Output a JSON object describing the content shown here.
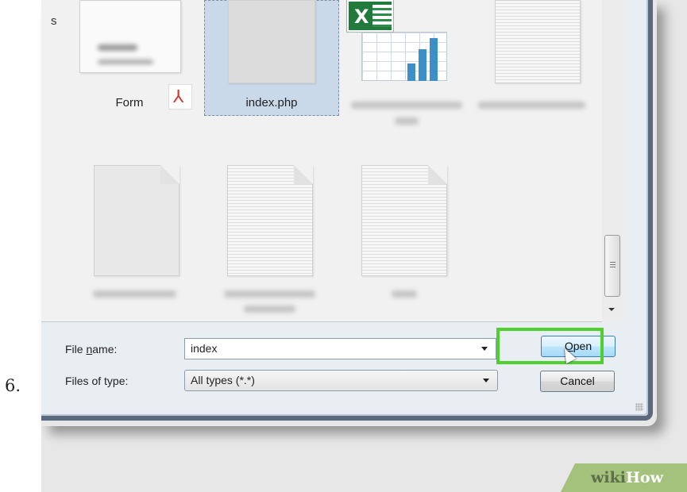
{
  "step": {
    "number": "6."
  },
  "file_pane": {
    "side_fragment": "s",
    "items": [
      {
        "label": "Form"
      },
      {
        "label": "index.php"
      }
    ]
  },
  "form": {
    "file_name_label_before": "File ",
    "file_name_label_accel": "n",
    "file_name_label_after": "ame:",
    "file_name_value": "index",
    "files_of_type_label": "Files of type:",
    "files_of_type_value": "All types (*.*)"
  },
  "buttons": {
    "open_accel": "O",
    "open_rest": "pen",
    "cancel": "Cancel"
  },
  "watermark": {
    "wiki": "wiki",
    "how": "How"
  },
  "colors": {
    "highlight": "#4ed12e",
    "watermark_bg": "#a5c27c",
    "selection": "#c9d9ea"
  }
}
